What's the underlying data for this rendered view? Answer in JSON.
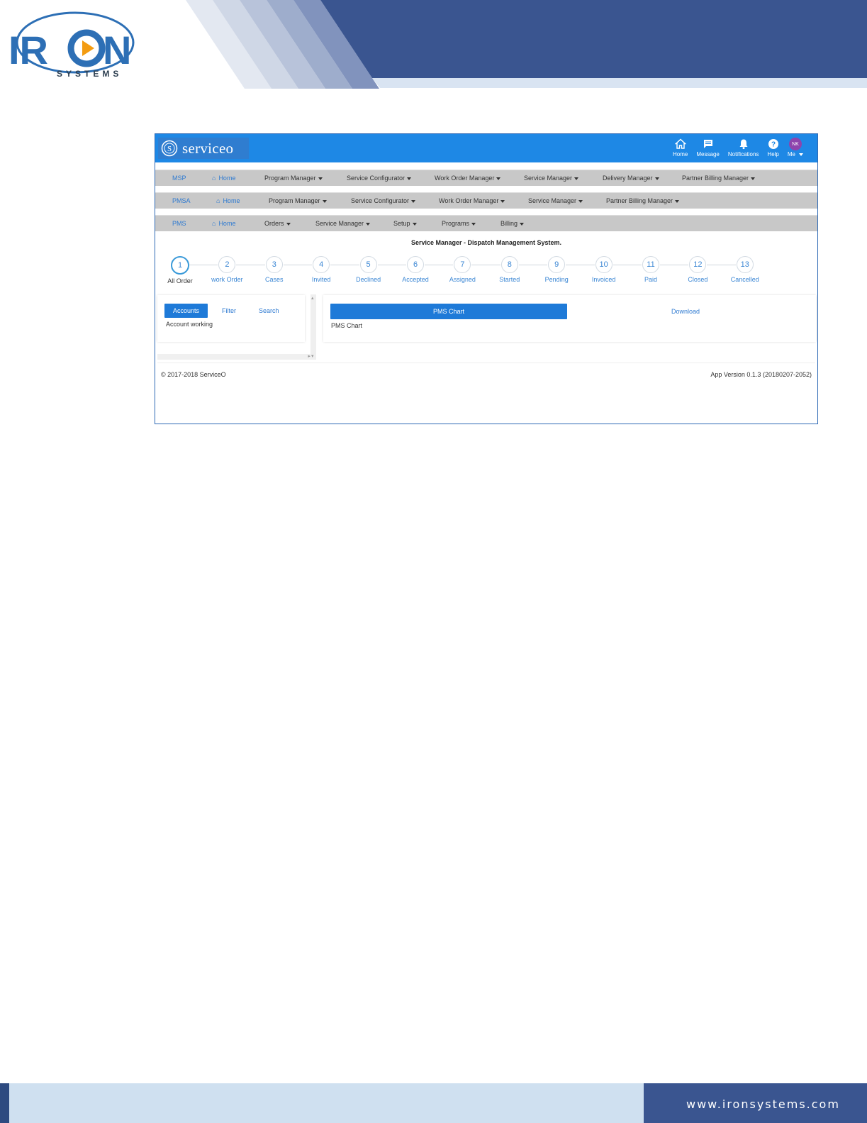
{
  "doc": {
    "logo_word_left": "IR",
    "logo_word_right": "N",
    "logo_subtitle": "SYSTEMS",
    "footer_url": "www.ironsystems.com",
    "colors": {
      "navy": "#3a5590",
      "band_light": "#cfe0f0"
    }
  },
  "app": {
    "brand": "serviceo",
    "topnav": [
      {
        "label": "Home",
        "icon": "home-icon"
      },
      {
        "label": "Message",
        "icon": "message-icon"
      },
      {
        "label": "Notifications",
        "icon": "bell-icon"
      },
      {
        "label": "Help",
        "icon": "help-icon"
      }
    ],
    "user": {
      "initials": "NK",
      "label": "Me"
    },
    "nav_msp": {
      "lead": "MSP",
      "home": "Home",
      "items": [
        "Program Manager",
        "Service Configurator",
        "Work Order Manager",
        "Service Manager",
        "Delivery Manager",
        "Partner Billing Manager"
      ]
    },
    "nav_pmsa": {
      "lead": "PMSA",
      "home": "Home",
      "items": [
        "Program Manager",
        "Service Configurator",
        "Work Order Manager",
        "Service Manager",
        "Partner Billing Manager"
      ]
    },
    "nav_pms": {
      "lead": "PMS",
      "home": "Home",
      "items": [
        "Orders",
        "Service Manager",
        "Setup",
        "Programs",
        "Billing"
      ]
    },
    "subtitle": "Service Manager - Dispatch Management System.",
    "steps": [
      {
        "num": "1",
        "label": "All Order"
      },
      {
        "num": "2",
        "label": "work Order"
      },
      {
        "num": "3",
        "label": "Cases"
      },
      {
        "num": "4",
        "label": "Invited"
      },
      {
        "num": "5",
        "label": "Declined"
      },
      {
        "num": "6",
        "label": "Accepted"
      },
      {
        "num": "7",
        "label": "Assigned"
      },
      {
        "num": "8",
        "label": "Started"
      },
      {
        "num": "9",
        "label": "Pending"
      },
      {
        "num": "10",
        "label": "Invoiced"
      },
      {
        "num": "11",
        "label": "Paid"
      },
      {
        "num": "12",
        "label": "Closed"
      },
      {
        "num": "13",
        "label": "Cancelled"
      }
    ],
    "active_step": 0,
    "left_panel": {
      "tabs": [
        "Accounts",
        "Filter",
        "Search"
      ],
      "active_tab": 0,
      "content": "Account working"
    },
    "right_panel": {
      "button": "PMS Chart",
      "download": "Download",
      "content": "PMS Chart"
    },
    "footer_left": "© 2017-2018 ServiceO",
    "footer_right": "App Version 0.1.3 (20180207-2052)",
    "colors": {
      "topbar": "#1e88e5",
      "nav_gray": "#c8c8c8",
      "accent": "#1e7ad8"
    }
  }
}
